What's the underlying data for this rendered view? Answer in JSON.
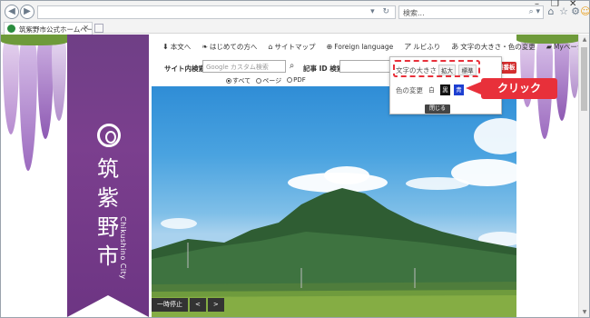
{
  "browser": {
    "search_placeholder": "検索...",
    "tab_title": "筑紫野市公式ホームページ",
    "window_controls": [
      "–",
      "❐",
      "✕"
    ]
  },
  "topnav": [
    {
      "icon": "⬇",
      "label": "本文へ"
    },
    {
      "icon": "❧",
      "label": "はじめての方へ"
    },
    {
      "icon": "⌂",
      "label": "サイトマップ"
    },
    {
      "icon": "⊕",
      "label": "Foreign language"
    },
    {
      "icon": "ア",
      "label": "ルビふり"
    },
    {
      "icon": "あ",
      "label": "文字の大きさ・色の変更"
    },
    {
      "icon": "▰",
      "label": "Myページ"
    }
  ],
  "search": {
    "site_label": "サイト内検索",
    "placeholder": "Google カスタム検索",
    "id_label": "記事 ID 検索",
    "options": [
      "すべて",
      "ページ",
      "PDF"
    ],
    "emergency_label": "緊急情報番板"
  },
  "city": {
    "kanji": [
      "筑",
      "紫",
      "野",
      "市"
    ],
    "roman": "Chikushino City"
  },
  "popup": {
    "font_size_label": "文字の大きさ",
    "enlarge": "拡大",
    "standard": "標準",
    "color_label": "色の変更",
    "white": "白",
    "black": "黒",
    "blue": "青",
    "close": "閉じる"
  },
  "callout": {
    "text": "クリック"
  },
  "slider": {
    "pause": "一時停止",
    "prev": "<",
    "next": ">"
  },
  "colors": {
    "banner": "#73398a",
    "accent": "#e8303a",
    "emergency": "#d32f2f"
  }
}
